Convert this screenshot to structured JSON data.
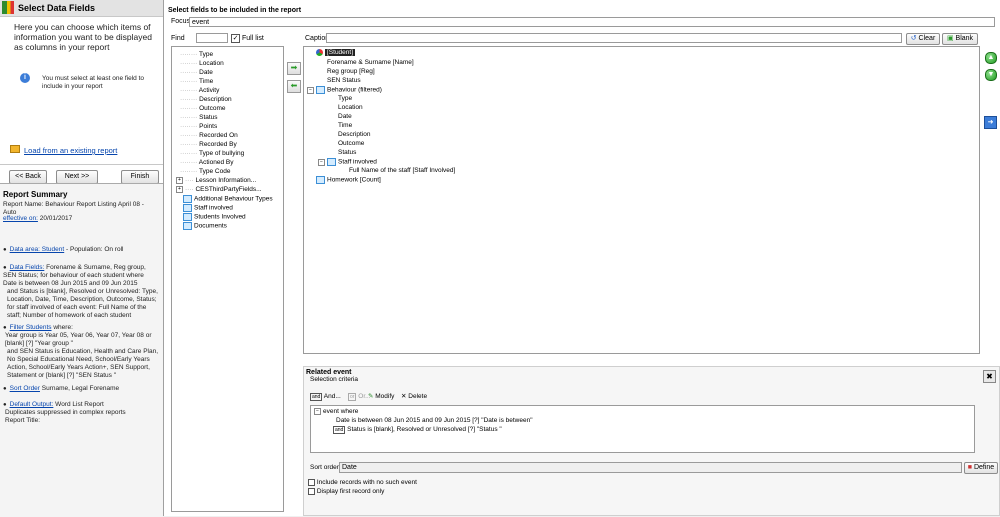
{
  "left": {
    "title": "Select Data Fields",
    "intro": "Here you can choose which items of information you want to be displayed as columns in your report",
    "info": "You must select at least one field to include in your report",
    "load_link": "Load from an existing report",
    "back_label": "<< Back",
    "next_label": "Next >>",
    "finish_label": "Finish"
  },
  "summary": {
    "heading": "Report Summary",
    "report_name": "Report Name: Behaviour Report Listing April 08 - Auto",
    "effective_link": "effective on:",
    "effective_date": "20/01/2017",
    "data_area_link": "Data area: Student",
    "data_area_rest": "- Population: On roll",
    "data_fields_link": "Data Fields:",
    "data_fields_rest": "Forename & Surname, Reg group, SEN Status; for behaviour of each student where Date is between 08 Jun 2015 and 09 Jun 2015",
    "data_fields_rest2": "and Status is [blank], Resolved or Unresolved: Type, Location, Date, Time, Description, Outcome, Status; for staff involved of each event: Full Name of the staff; Number of homework of each student",
    "filter_link": "Filter Students",
    "filter_rest": "where:",
    "filter_rest2": "Year group is Year 05, Year 06, Year 07, Year 08 or [blank] [?] \"Year group \"",
    "filter_rest3": "and SEN Status is Education, Health and Care Plan, No Special Educational Need, School/Early Years Action, School/Early Years Action+, SEN Support, Statement or [blank] [?] \"SEN Status \"",
    "sort_link": "Sort Order",
    "sort_rest": "Surname, Legal Forename",
    "output_link": "Default Output:",
    "output_rest": "Word List Report",
    "output_rest2": "Duplicates suppressed in complex reports",
    "output_rest3": "Report Title:"
  },
  "main": {
    "title": "Select fields to be included in the report",
    "focus_label": "Focus",
    "focus_value": "event",
    "find_label": "Find",
    "find_value": "",
    "full_list_label": "Full list",
    "caption_label": "Caption",
    "caption_value": "",
    "clear_label": "Clear",
    "blank_label": "Blank"
  },
  "field_list": [
    "Type",
    "Location",
    "Date",
    "Time",
    "Activity",
    "Description",
    "Outcome",
    "Status",
    "Points",
    "Recorded On",
    "Recorded By",
    "Type of bullying",
    "Actioned By",
    "Type Code",
    "Lesson Information...",
    "CESThirdPartyFields...",
    "Additional Behaviour Types",
    "Staff involved",
    "Students Involved",
    "Documents"
  ],
  "selected_tree": {
    "root": "[Student]",
    "items": [
      "Forename & Surname [Name]",
      "Reg group [Reg]",
      "SEN Status"
    ],
    "behaviour": "Behaviour (filtered)",
    "behaviour_items": [
      "Type",
      "Location",
      "Date",
      "Time",
      "Description",
      "Outcome",
      "Status"
    ],
    "staff": "Staff involved",
    "staff_item": "Full Name of the staff [Staff Involved]",
    "homework": "Homework [Count]"
  },
  "related": {
    "title": "Related event",
    "criteria_label": "Selection criteria",
    "and_label": "And...",
    "or_label": "Or...",
    "modify_label": "Modify",
    "delete_label": "Delete",
    "root": "event where",
    "crit1": "Date is between 08 Jun 2015 and 09 Jun 2015 [?] \"Date is between\"",
    "crit2": "Status is [blank], Resolved or Unresolved [?] \"Status \"",
    "sort_label": "Sort order",
    "sort_value": "Date",
    "define_label": "Define",
    "opt1": "Include records with no such event",
    "opt2": "Display first record only"
  }
}
